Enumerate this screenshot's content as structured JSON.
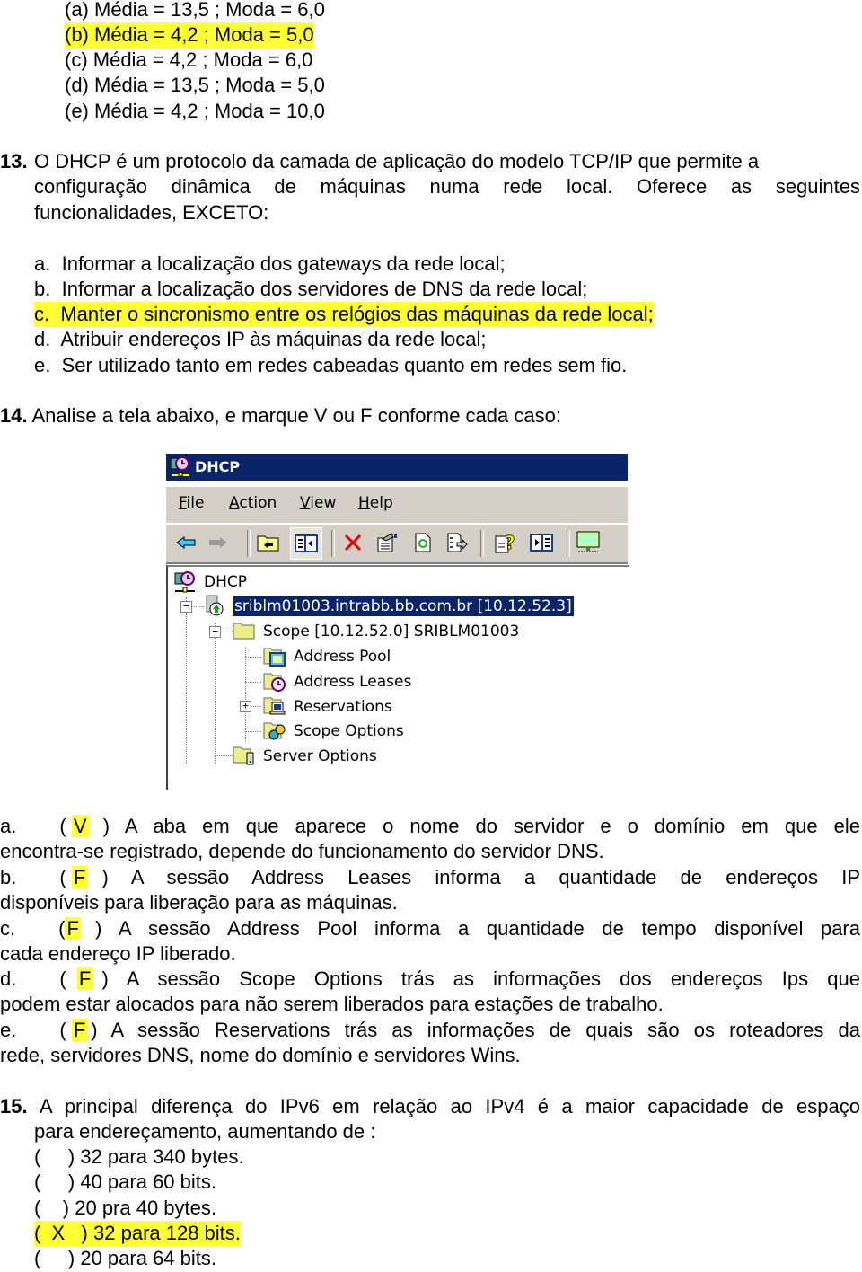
{
  "q12_options": [
    {
      "label": "(a) Média = 13,5 ; Moda = 6,0",
      "highlighted": false
    },
    {
      "label": "(b) Média = 4,2 ; Moda = 5,0",
      "highlighted": true
    },
    {
      "label": "(c) Média = 4,2 ; Moda = 6,0",
      "highlighted": false
    },
    {
      "label": "(d) Média = 13,5 ; Moda = 5,0",
      "highlighted": false
    },
    {
      "label": "(e) Média = 4,2 ; Moda = 10,0",
      "highlighted": false
    }
  ],
  "q13": {
    "number": "13.",
    "text_line1": "O DHCP é um protocolo da camada de aplicação do modelo TCP/IP que permite a",
    "text_line2": "configuração dinâmica de máquinas numa rede local. Oferece as seguintes",
    "text_line3": "funcionalidades, EXCETO:",
    "options": [
      {
        "letter": "a.",
        "text": "Informar a localização dos gateways da rede local;",
        "highlighted": false
      },
      {
        "letter": "b.",
        "text": "Informar a localização dos servidores de DNS da rede local;",
        "highlighted": false
      },
      {
        "letter": "c.",
        "text": "Manter o sincronismo entre os relógios das máquinas da rede local;",
        "highlighted": true
      },
      {
        "letter": "d.",
        "text": "Atribuir endereços IP às máquinas da rede local;",
        "highlighted": false
      },
      {
        "letter": "e.",
        "text": "Ser utilizado tanto em redes cabeadas quanto em redes sem fio.",
        "highlighted": false
      }
    ]
  },
  "q14": {
    "number": "14.",
    "text": "Analise a tela abaixo, e marque V ou F conforme cada caso:",
    "window": {
      "title": "DHCP",
      "menu": [
        "File",
        "Action",
        "View",
        "Help"
      ],
      "menu_mnemonics": [
        "F",
        "A",
        "V",
        "H"
      ],
      "toolbar_icons": [
        "back-arrow-icon",
        "forward-arrow-icon",
        "up-one-level-icon",
        "show-hide-console-tree-icon",
        "delete-icon",
        "properties-icon",
        "refresh-icon",
        "export-list-icon",
        "help-icon",
        "show-hide-action-pane-icon",
        "monitor-icon"
      ],
      "tree": {
        "root": "DHCP",
        "server": "sriblm01003.intrabb.bb.com.br [10.12.52.3]",
        "scope": "Scope [10.12.52.0] SRIBLM01003",
        "scope_children": [
          "Address Pool",
          "Address Leases",
          "Reservations",
          "Scope Options"
        ],
        "server_options": "Server Options"
      }
    },
    "items": [
      {
        "letter": "a.",
        "answer": "V",
        "line1": ") A aba em que aparece o nome do servidor e o domínio em que ele",
        "line2": "encontra-se registrado, depende do funcionamento do servidor DNS."
      },
      {
        "letter": "b.",
        "answer": "F",
        "line1": ") A sessão Address Leases informa a quantidade de endereços IP",
        "line2": "disponíveis para liberação para as máquinas."
      },
      {
        "letter": "c.",
        "answer": "F",
        "line1": ") A sessão Address Pool informa a quantidade de tempo disponível para",
        "line2": "cada endereço IP liberado."
      },
      {
        "letter": "d.",
        "answer": "F",
        "line1": ")  A sessão Scope Options trás as informações dos endereços Ips que",
        "line2": "podem estar alocados para não serem liberados para estações de trabalho."
      },
      {
        "letter": "e.",
        "answer": "F",
        "line1": ") A sessão Reservations trás as informações de quais são os roteadores da",
        "line2": "rede, servidores DNS, nome do domínio e servidores Wins."
      }
    ]
  },
  "q15": {
    "number": "15.",
    "text_line1": "A principal diferença do IPv6 em relação ao IPv4 é a maior capacidade de espaço",
    "text_line2": "para endereçamento, aumentando de :",
    "options": [
      {
        "mark": "(     )",
        "text": "32 para 340 bytes.",
        "highlighted": false
      },
      {
        "mark": "(     )",
        "text": "40 para 60 bits.",
        "highlighted": false
      },
      {
        "mark": "(    )",
        "text": "20 pra 40 bytes.",
        "highlighted": false
      },
      {
        "mark": "(  X   )",
        "text": "32 para 128 bits.",
        "highlighted": true
      },
      {
        "mark": "(     )",
        "text": "20 para 64 bits.",
        "highlighted": false
      }
    ]
  }
}
